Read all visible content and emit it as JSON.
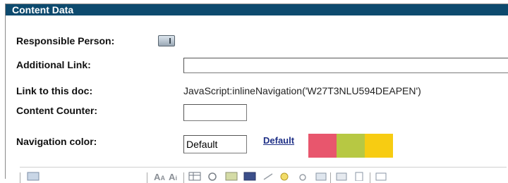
{
  "section": {
    "title": "Content Data"
  },
  "fields": {
    "responsible_person": {
      "label": "Responsible Person:"
    },
    "additional_link": {
      "label": "Additional Link:",
      "value": ""
    },
    "link_to_doc": {
      "label": "Link to this doc:",
      "value": "JavaScript:inlineNavigation('W27T3NLU594DEAPEN')"
    },
    "content_counter": {
      "label": "Content Counter:",
      "value": ""
    },
    "navigation_color": {
      "label": "Navigation color:",
      "value": "Default",
      "default_link": "Default"
    }
  },
  "color_swatches": [
    "#e8566d",
    "#b7c843",
    "#f7cc12"
  ],
  "icons": {
    "person_picker": "address-book-icon",
    "toolbar": [
      "insert-icon",
      "font-size-icon",
      "font-icon",
      "table-icon",
      "link-icon",
      "image-icon",
      "media-icon",
      "globe-icon",
      "anchor-icon",
      "attachment-icon",
      "spellcheck-icon",
      "paste-icon",
      "help-icon"
    ]
  }
}
